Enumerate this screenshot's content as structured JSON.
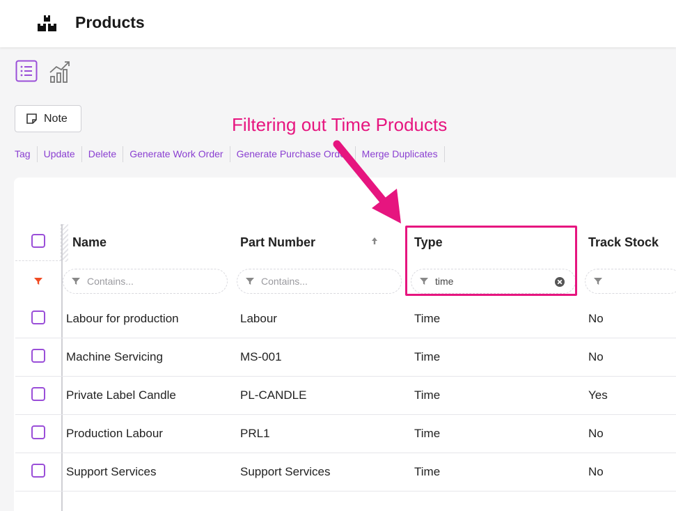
{
  "header": {
    "title": "Products",
    "app_icon": "boxes-icon"
  },
  "view_switcher": {
    "list_icon": "list-view-icon",
    "chart_icon": "chart-view-icon"
  },
  "toolbar": {
    "note_label": "Note"
  },
  "actions": [
    "Tag",
    "Update",
    "Delete",
    "Generate Work Order",
    "Generate Purchase Order",
    "Merge Duplicates"
  ],
  "annotation": {
    "text": "Filtering out Time Products",
    "color": "#e6157f"
  },
  "grid": {
    "columns": [
      "Name",
      "Part Number",
      "Type",
      "Track Stock"
    ],
    "filters": {
      "name_placeholder": "Contains...",
      "part_number_placeholder": "Contains...",
      "type_value": "time"
    },
    "rows": [
      {
        "name": "Labour for production",
        "part_number": "Labour",
        "type": "Time",
        "track_stock": "No"
      },
      {
        "name": "Machine Servicing",
        "part_number": "MS-001",
        "type": "Time",
        "track_stock": "No"
      },
      {
        "name": "Private Label Candle",
        "part_number": "PL-CANDLE",
        "type": "Time",
        "track_stock": "Yes"
      },
      {
        "name": "Production Labour",
        "part_number": "PRL1",
        "type": "Time",
        "track_stock": "No"
      },
      {
        "name": "Support Services",
        "part_number": "Support Services",
        "type": "Time",
        "track_stock": "No"
      }
    ]
  },
  "colors": {
    "accent": "#8a3fd1",
    "highlight": "#e6157f",
    "filter_active": "#f04b23"
  }
}
